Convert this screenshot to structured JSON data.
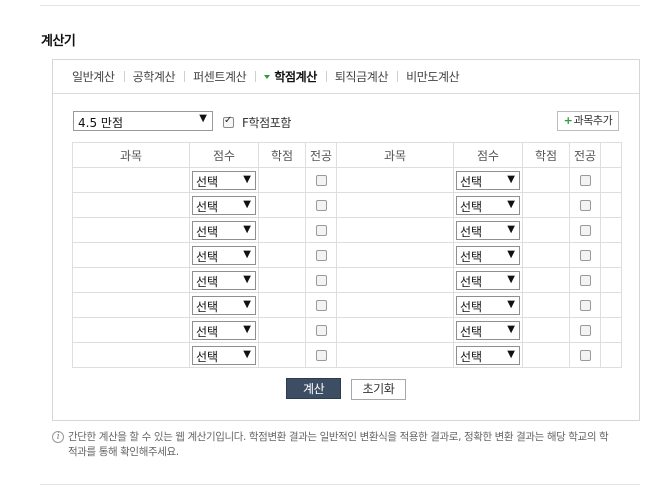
{
  "section_title": "계산기",
  "tabs": [
    {
      "label": "일반계산",
      "active": false
    },
    {
      "label": "공학계산",
      "active": false
    },
    {
      "label": "퍼센트계산",
      "active": false
    },
    {
      "label": "학점계산",
      "active": true
    },
    {
      "label": "퇴직금계산",
      "active": false
    },
    {
      "label": "비만도계산",
      "active": false
    }
  ],
  "scale_select": {
    "value": "4.5 만점",
    "arrow": "▼"
  },
  "f_include": {
    "label": "F학점포함",
    "checked": true
  },
  "add_course_button": {
    "plus": "+",
    "label": "과목추가"
  },
  "table": {
    "headers": [
      "과목",
      "점수",
      "학점",
      "전공",
      "과목",
      "점수",
      "학점",
      "전공"
    ],
    "row_count": 8,
    "score_placeholder": "선택",
    "arrow": "▼"
  },
  "buttons": {
    "calculate": "계산",
    "reset": "초기화"
  },
  "note": {
    "icon": "i",
    "text": "간단한 계산을 할 수 있는 웹 계산기입니다. 학점변환 결과는 일반적인 변환식을 적용한 결과로, 정확한 변환 결과는 해당 학교의 학적과를 통해 확인해주세요."
  },
  "colors": {
    "active_arrow": "#2e9d3c",
    "calc_button_bg": "#3d4d63"
  }
}
